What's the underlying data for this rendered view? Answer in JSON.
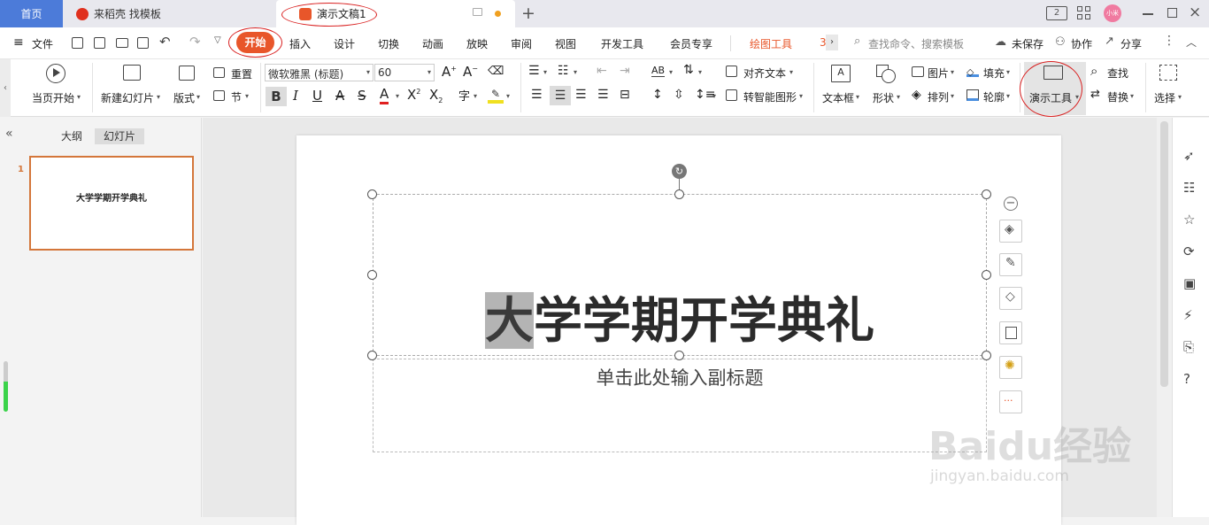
{
  "titlebar": {
    "tabs": [
      {
        "label": "首页"
      },
      {
        "label": "来稻壳 找模板"
      },
      {
        "label": "演示文稿1"
      }
    ],
    "badge": "2",
    "avatar": "小米"
  },
  "menubar": {
    "file": "文件",
    "items": [
      "开始",
      "插入",
      "设计",
      "切换",
      "动画",
      "放映",
      "审阅",
      "视图",
      "开发工具",
      "会员专享"
    ],
    "drawing_tools": "绘图工具",
    "search_placeholder": "查找命令、搜索模板",
    "unsaved": "未保存",
    "collab": "协作",
    "share": "分享"
  },
  "ribbon": {
    "from_current": "当页开始",
    "new_slide": "新建幻灯片",
    "layout": "版式",
    "reset": "重置",
    "section": "节",
    "font_name": "微软雅黑 (标题)",
    "font_size": "60",
    "align_text": "对齐文本",
    "smart_shape": "转智能图形",
    "textbox": "文本框",
    "shape": "形状",
    "picture": "图片",
    "arrange": "排列",
    "fill": "填充",
    "outline": "轮廓",
    "demo_tools": "演示工具",
    "find": "查找",
    "replace": "替换",
    "select": "选择"
  },
  "leftpanel": {
    "outline_tab": "大纲",
    "slides_tab": "幻灯片",
    "slide_number": "1",
    "thumb_title": "大学学期开学典礼"
  },
  "slide": {
    "title_first": "大",
    "title_rest": "学学期开学典礼",
    "subtitle": "单击此处输入副标题"
  },
  "watermark": {
    "brand": "Baidu经验",
    "url": "jingyan.baidu.com"
  },
  "colors": {
    "accent": "#4c7bd9",
    "active_tab": "#e8562a",
    "annotation": "#d92020",
    "drawing_tools": "#e8562a"
  }
}
